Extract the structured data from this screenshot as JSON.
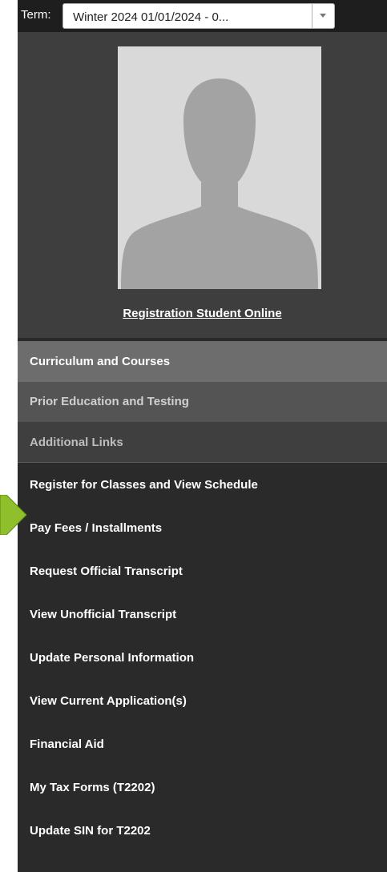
{
  "term": {
    "label": "Term:",
    "selected": "Winter 2024 01/01/2024 - 0..."
  },
  "profile": {
    "link_text": "Registration Student Online"
  },
  "sections": [
    {
      "label": "Curriculum and Courses"
    },
    {
      "label": "Prior Education and Testing"
    },
    {
      "label": "Additional Links"
    }
  ],
  "links": [
    {
      "label": "Register for Classes and View Schedule"
    },
    {
      "label": "Pay Fees / Installments"
    },
    {
      "label": "Request Official Transcript"
    },
    {
      "label": "View Unofficial Transcript"
    },
    {
      "label": "Update Personal Information"
    },
    {
      "label": "View Current Application(s)"
    },
    {
      "label": "Financial Aid"
    },
    {
      "label": "My Tax Forms (T2202)"
    },
    {
      "label": "Update SIN for T2202"
    }
  ],
  "colors": {
    "panel_bg": "#2a2a2a",
    "highlight_arrow": "#8fbf2a"
  },
  "icons": {
    "term_dropdown": "chevron-down-icon",
    "avatar": "person-silhouette-icon",
    "pointer": "arrow-right-icon"
  }
}
